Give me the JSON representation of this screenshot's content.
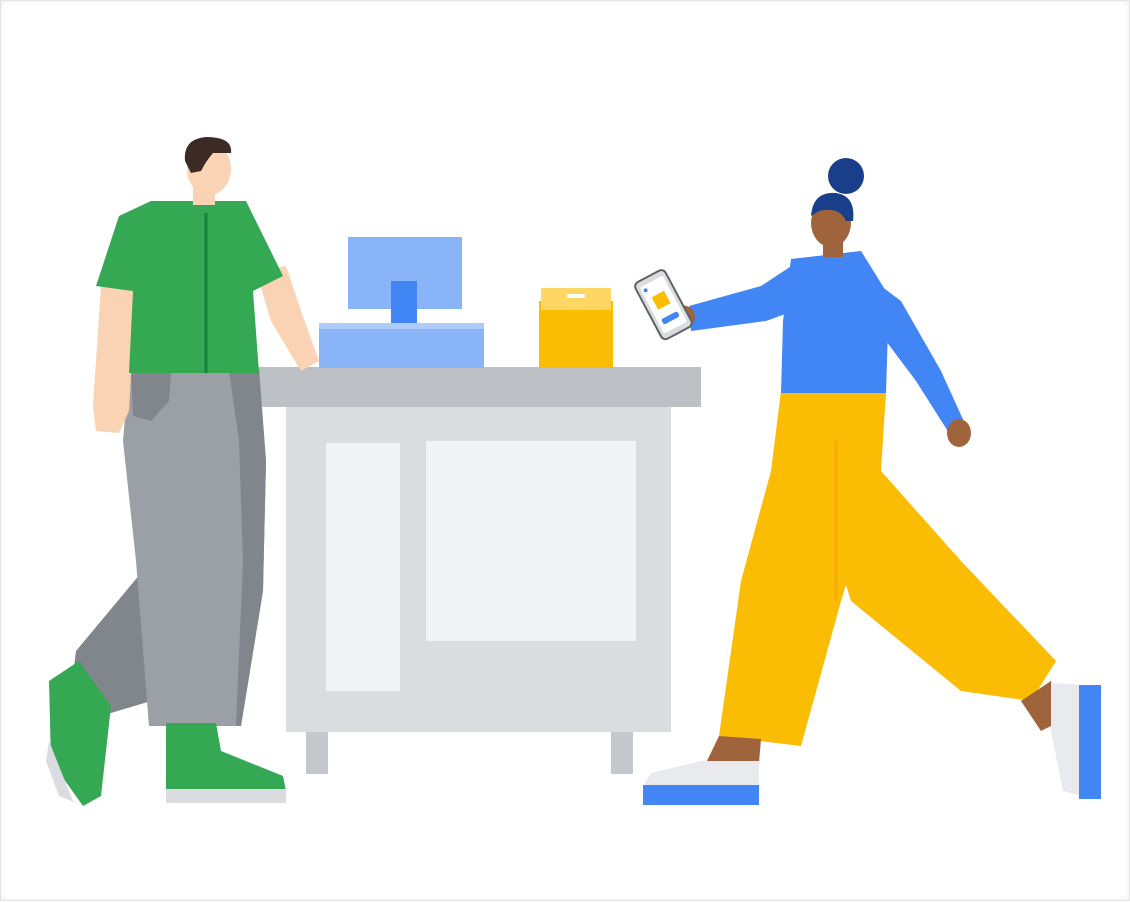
{
  "illustration": {
    "subject": "checkout-counter-mobile-payment",
    "colors": {
      "background": "#ffffff",
      "counter_top": "#bdc1c6",
      "counter_body": "#dadce0",
      "counter_panel": "#f1f3f4",
      "counter_leg": "#c4c7cc",
      "monitor": "#8ab4f8",
      "monitor_dark": "#669df6",
      "register_base": "#8ab4f8",
      "bag": "#fbbc04",
      "bag_light": "#fdd663",
      "clerk_shirt": "#34a853",
      "clerk_pants": "#9aa0a6",
      "clerk_pants_dark": "#80868b",
      "clerk_shoes": "#34a853",
      "clerk_skin": "#fad2b4",
      "clerk_hair": "#3c2a24",
      "customer_sweater": "#4285f4",
      "customer_pants": "#fbbc04",
      "customer_skin": "#a0643c",
      "customer_hair": "#1a3f8a",
      "customer_shoes": "#e8eaed",
      "customer_shoe_sole": "#4285f4",
      "phone_body": "#dadce0",
      "phone_screen": "#ffffff",
      "phone_accent": "#fbbc04",
      "phone_button": "#4285f4"
    },
    "icons": {
      "cash_register": "desktop-monitor-icon",
      "shopping_bag": "shopping-bag-icon",
      "smartphone": "smartphone-icon"
    }
  }
}
